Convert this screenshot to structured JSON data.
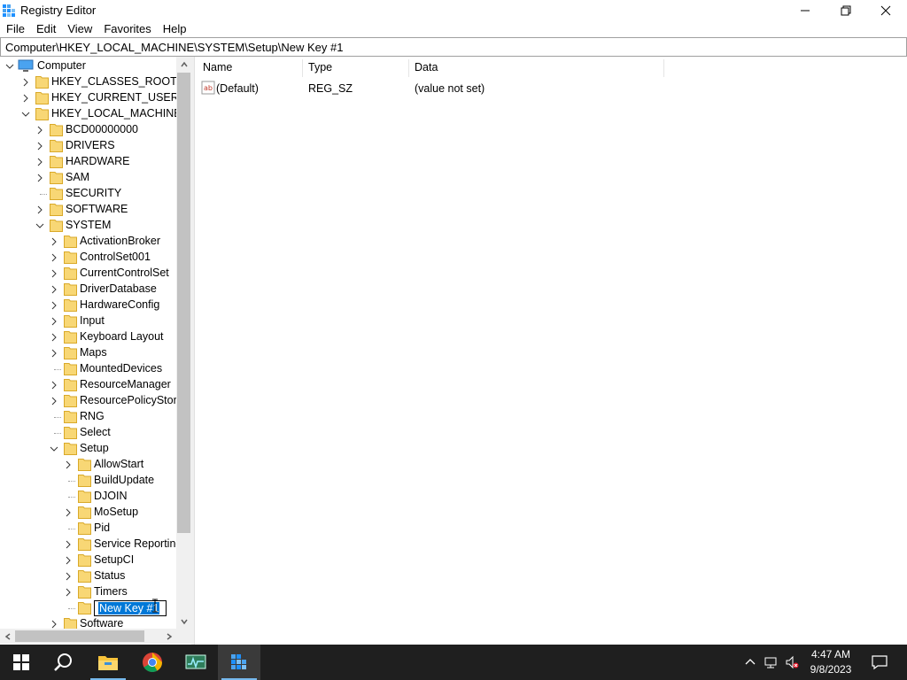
{
  "window": {
    "title": "Registry Editor"
  },
  "menu": [
    "File",
    "Edit",
    "View",
    "Favorites",
    "Help"
  ],
  "address": "Computer\\HKEY_LOCAL_MACHINE\\SYSTEM\\Setup\\New Key #1",
  "tree": {
    "root": "Computer",
    "items": [
      {
        "label": "HKEY_CLASSES_ROOT",
        "state": "collapsed"
      },
      {
        "label": "HKEY_CURRENT_USER",
        "state": "collapsed"
      },
      {
        "label": "HKEY_LOCAL_MACHINE",
        "state": "expanded"
      },
      {
        "label": "BCD00000000",
        "state": "collapsed"
      },
      {
        "label": "DRIVERS",
        "state": "collapsed"
      },
      {
        "label": "HARDWARE",
        "state": "collapsed"
      },
      {
        "label": "SAM",
        "state": "collapsed"
      },
      {
        "label": "SECURITY",
        "state": "leaf"
      },
      {
        "label": "SOFTWARE",
        "state": "collapsed"
      },
      {
        "label": "SYSTEM",
        "state": "expanded"
      },
      {
        "label": "ActivationBroker",
        "state": "collapsed"
      },
      {
        "label": "ControlSet001",
        "state": "collapsed"
      },
      {
        "label": "CurrentControlSet",
        "state": "collapsed"
      },
      {
        "label": "DriverDatabase",
        "state": "collapsed"
      },
      {
        "label": "HardwareConfig",
        "state": "collapsed"
      },
      {
        "label": "Input",
        "state": "collapsed"
      },
      {
        "label": "Keyboard Layout",
        "state": "collapsed"
      },
      {
        "label": "Maps",
        "state": "collapsed"
      },
      {
        "label": "MountedDevices",
        "state": "leaf"
      },
      {
        "label": "ResourceManager",
        "state": "collapsed"
      },
      {
        "label": "ResourcePolicyStore",
        "state": "collapsed"
      },
      {
        "label": "RNG",
        "state": "leaf"
      },
      {
        "label": "Select",
        "state": "leaf"
      },
      {
        "label": "Setup",
        "state": "expanded"
      },
      {
        "label": "AllowStart",
        "state": "collapsed"
      },
      {
        "label": "BuildUpdate",
        "state": "leaf"
      },
      {
        "label": "DJOIN",
        "state": "leaf"
      },
      {
        "label": "MoSetup",
        "state": "collapsed"
      },
      {
        "label": "Pid",
        "state": "leaf"
      },
      {
        "label": "Service Reporting",
        "state": "collapsed"
      },
      {
        "label": "SetupCI",
        "state": "collapsed"
      },
      {
        "label": "Status",
        "state": "collapsed"
      },
      {
        "label": "Timers",
        "state": "collapsed"
      },
      {
        "label": "New Key #1",
        "state": "editing"
      },
      {
        "label": "Software",
        "state": "collapsed"
      }
    ]
  },
  "list": {
    "columns": [
      "Name",
      "Type",
      "Data"
    ],
    "rows": [
      {
        "name": "(Default)",
        "type": "REG_SZ",
        "data": "(value not set)"
      }
    ]
  },
  "taskbar": {
    "apps": [
      "start",
      "search",
      "file-explorer",
      "chrome",
      "task-manager",
      "registry-editor"
    ],
    "active": "registry-editor",
    "time": "4:47 AM",
    "date": "9/8/2023"
  },
  "colors": {
    "selection": "#0078d7",
    "taskbar": "#1f1f1f",
    "folder": "#f8d775"
  }
}
